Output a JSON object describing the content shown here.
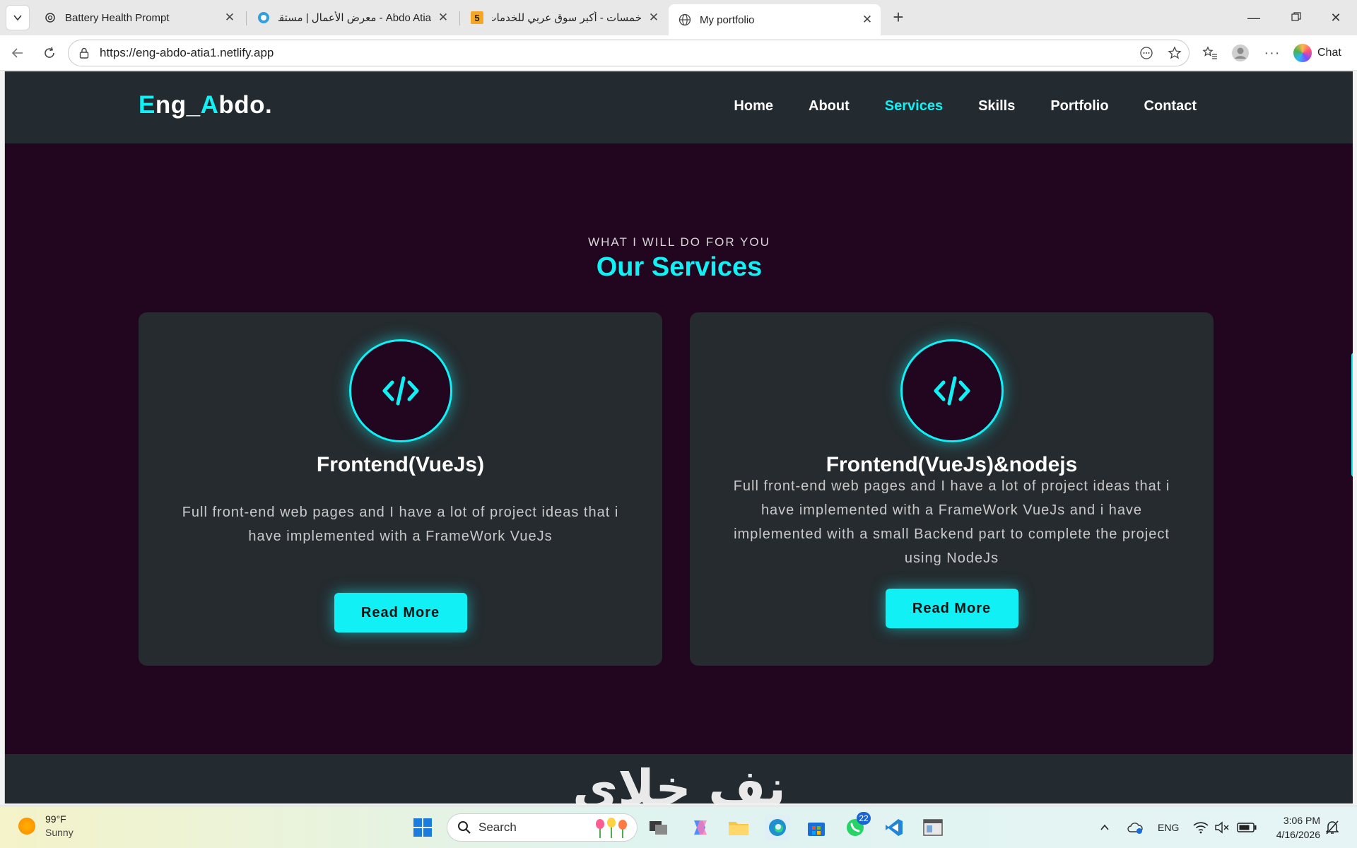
{
  "browser": {
    "tabs": [
      {
        "title": "Battery Health Prompt",
        "icon": "openai-icon"
      },
      {
        "title": "Abdo Atia - معرض الأعمال | مستقل",
        "icon": "mostaql-icon"
      },
      {
        "title": "خمسات - أكبر سوق عربي للخدمات الـ",
        "icon": "khamsat-icon",
        "icon_text": "5"
      },
      {
        "title": "My portfolio",
        "icon": "globe-icon",
        "active": true
      }
    ],
    "url": "https://eng-abdo-atia1.netlify.app",
    "chat_label": "Chat"
  },
  "site": {
    "logo_first_letter": "E",
    "logo_part1": "ng_",
    "logo_second_letter": "A",
    "logo_part2": "bdo.",
    "nav": [
      {
        "label": "Home"
      },
      {
        "label": "About"
      },
      {
        "label": "Services",
        "active": true
      },
      {
        "label": "Skills"
      },
      {
        "label": "Portfolio"
      },
      {
        "label": "Contact"
      }
    ],
    "accent_color": "#10f0f5",
    "section_subtitle": "WHAT I WILL DO FOR YOU",
    "section_title": "Our Services",
    "cards": [
      {
        "icon": "code-icon",
        "title": "Frontend(VueJs)",
        "description": "Full front-end web pages and I have a lot of project ideas that i have implemented with a FrameWork VueJs",
        "button": "Read More"
      },
      {
        "icon": "code-icon",
        "title": "Frontend(VueJs)&nodejs",
        "description": "Full front-end web pages and I have a lot of project ideas that i have implemented with a FrameWork VueJs and i have implemented with a small Backend part to complete the project using NodeJs",
        "button": "Read More"
      }
    ],
    "next_section_heading": "نف خلاي"
  },
  "taskbar": {
    "weather_temp": "99°F",
    "weather_desc": "Sunny",
    "search_label": "Search",
    "whatsapp_badge": "22",
    "language": "ENG",
    "time": "3:06 PM",
    "date": "4/16/2026"
  }
}
